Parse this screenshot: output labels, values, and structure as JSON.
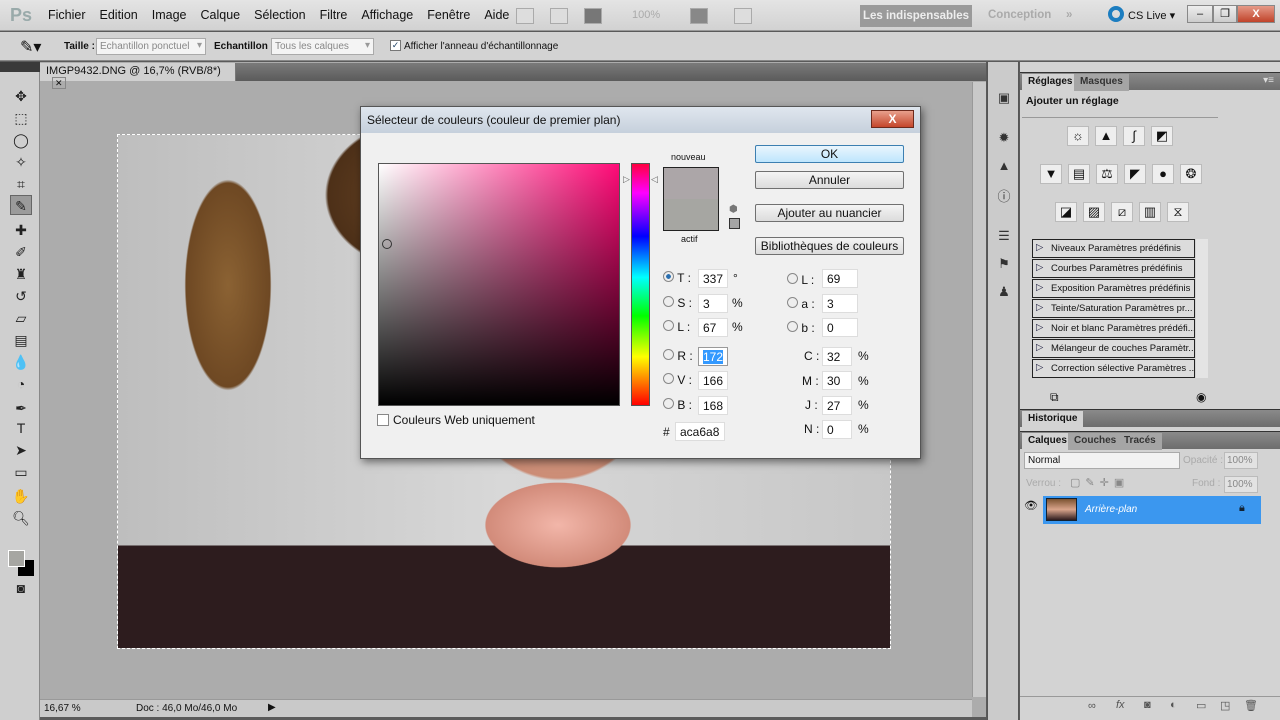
{
  "app": {
    "logo": "Ps",
    "menu": [
      "Fichier",
      "Edition",
      "Image",
      "Calque",
      "Sélection",
      "Filtre",
      "Affichage",
      "Fenêtre",
      "Aide"
    ],
    "zoom_dropdown": "100%",
    "workspaces": {
      "active": "Les indispensables",
      "other": "Conception",
      "more": "»"
    },
    "cs_live": "CS Live ▾",
    "window_buttons": {
      "minimize": "–",
      "restore": "❐",
      "close": "X"
    }
  },
  "options": {
    "size_label": "Taille :",
    "size_value": "Echantillon ponctuel",
    "sample_label": "Echantillon :",
    "sample_value": "Tous les calques",
    "show_ring_label": "Afficher l'anneau d'échantillonnage",
    "show_ring_checked": true
  },
  "document": {
    "tab_title": "IMGP9432.DNG @ 16,7% (RVB/8*)",
    "close": "✕",
    "zoom": "16,67 %",
    "doc_info": "Doc : 46,0 Mo/46,0 Mo"
  },
  "dialog": {
    "title": "Sélecteur de couleurs (couleur de premier plan)",
    "close": "X",
    "new_label": "nouveau",
    "current_label": "actif",
    "new_color": "#aca6a8",
    "current_color": "#a6a6a2",
    "buttons": {
      "ok": "OK",
      "cancel": "Annuler",
      "add_swatch": "Ajouter au nuancier",
      "libraries": "Bibliothèques de couleurs"
    },
    "web_only_label": "Couleurs Web uniquement",
    "hsb": [
      {
        "label": "T :",
        "value": "337",
        "unit": "°",
        "selected": true
      },
      {
        "label": "S :",
        "value": "3",
        "unit": "%"
      },
      {
        "label": "L :",
        "value": "67",
        "unit": "%"
      }
    ],
    "rgb": [
      {
        "label": "R :",
        "value": "172"
      },
      {
        "label": "V :",
        "value": "166"
      },
      {
        "label": "B :",
        "value": "168"
      }
    ],
    "lab": [
      {
        "label": "L :",
        "value": "69"
      },
      {
        "label": "a :",
        "value": "3"
      },
      {
        "label": "b :",
        "value": "0"
      }
    ],
    "cmyk": [
      {
        "label": "C :",
        "value": "32",
        "unit": "%"
      },
      {
        "label": "M :",
        "value": "30",
        "unit": "%"
      },
      {
        "label": "J :",
        "value": "27",
        "unit": "%"
      },
      {
        "label": "N :",
        "value": "0",
        "unit": "%"
      }
    ],
    "hex_label": "#",
    "hex": "aca6a8"
  },
  "adjustments": {
    "tabs": [
      "Réglages",
      "Masques"
    ],
    "heading": "Ajouter un réglage",
    "presets": [
      "Niveaux Paramètres prédéfinis",
      "Courbes Paramètres prédéfinis",
      "Exposition Paramètres prédéfinis",
      "Teinte/Saturation Paramètres pr...",
      "Noir et blanc Paramètres prédéfi...",
      "Mélangeur de couches Paramètr...",
      "Correction sélective Paramètres ..."
    ]
  },
  "history": {
    "tab": "Historique"
  },
  "layers": {
    "tabs": [
      "Calques",
      "Couches",
      "Tracés"
    ],
    "blend": "Normal",
    "opacity_label": "Opacité :",
    "opacity": "100%",
    "lock_label": "Verrou :",
    "fill_label": "Fond :",
    "fill": "100%",
    "layer_name": "Arrière-plan"
  }
}
